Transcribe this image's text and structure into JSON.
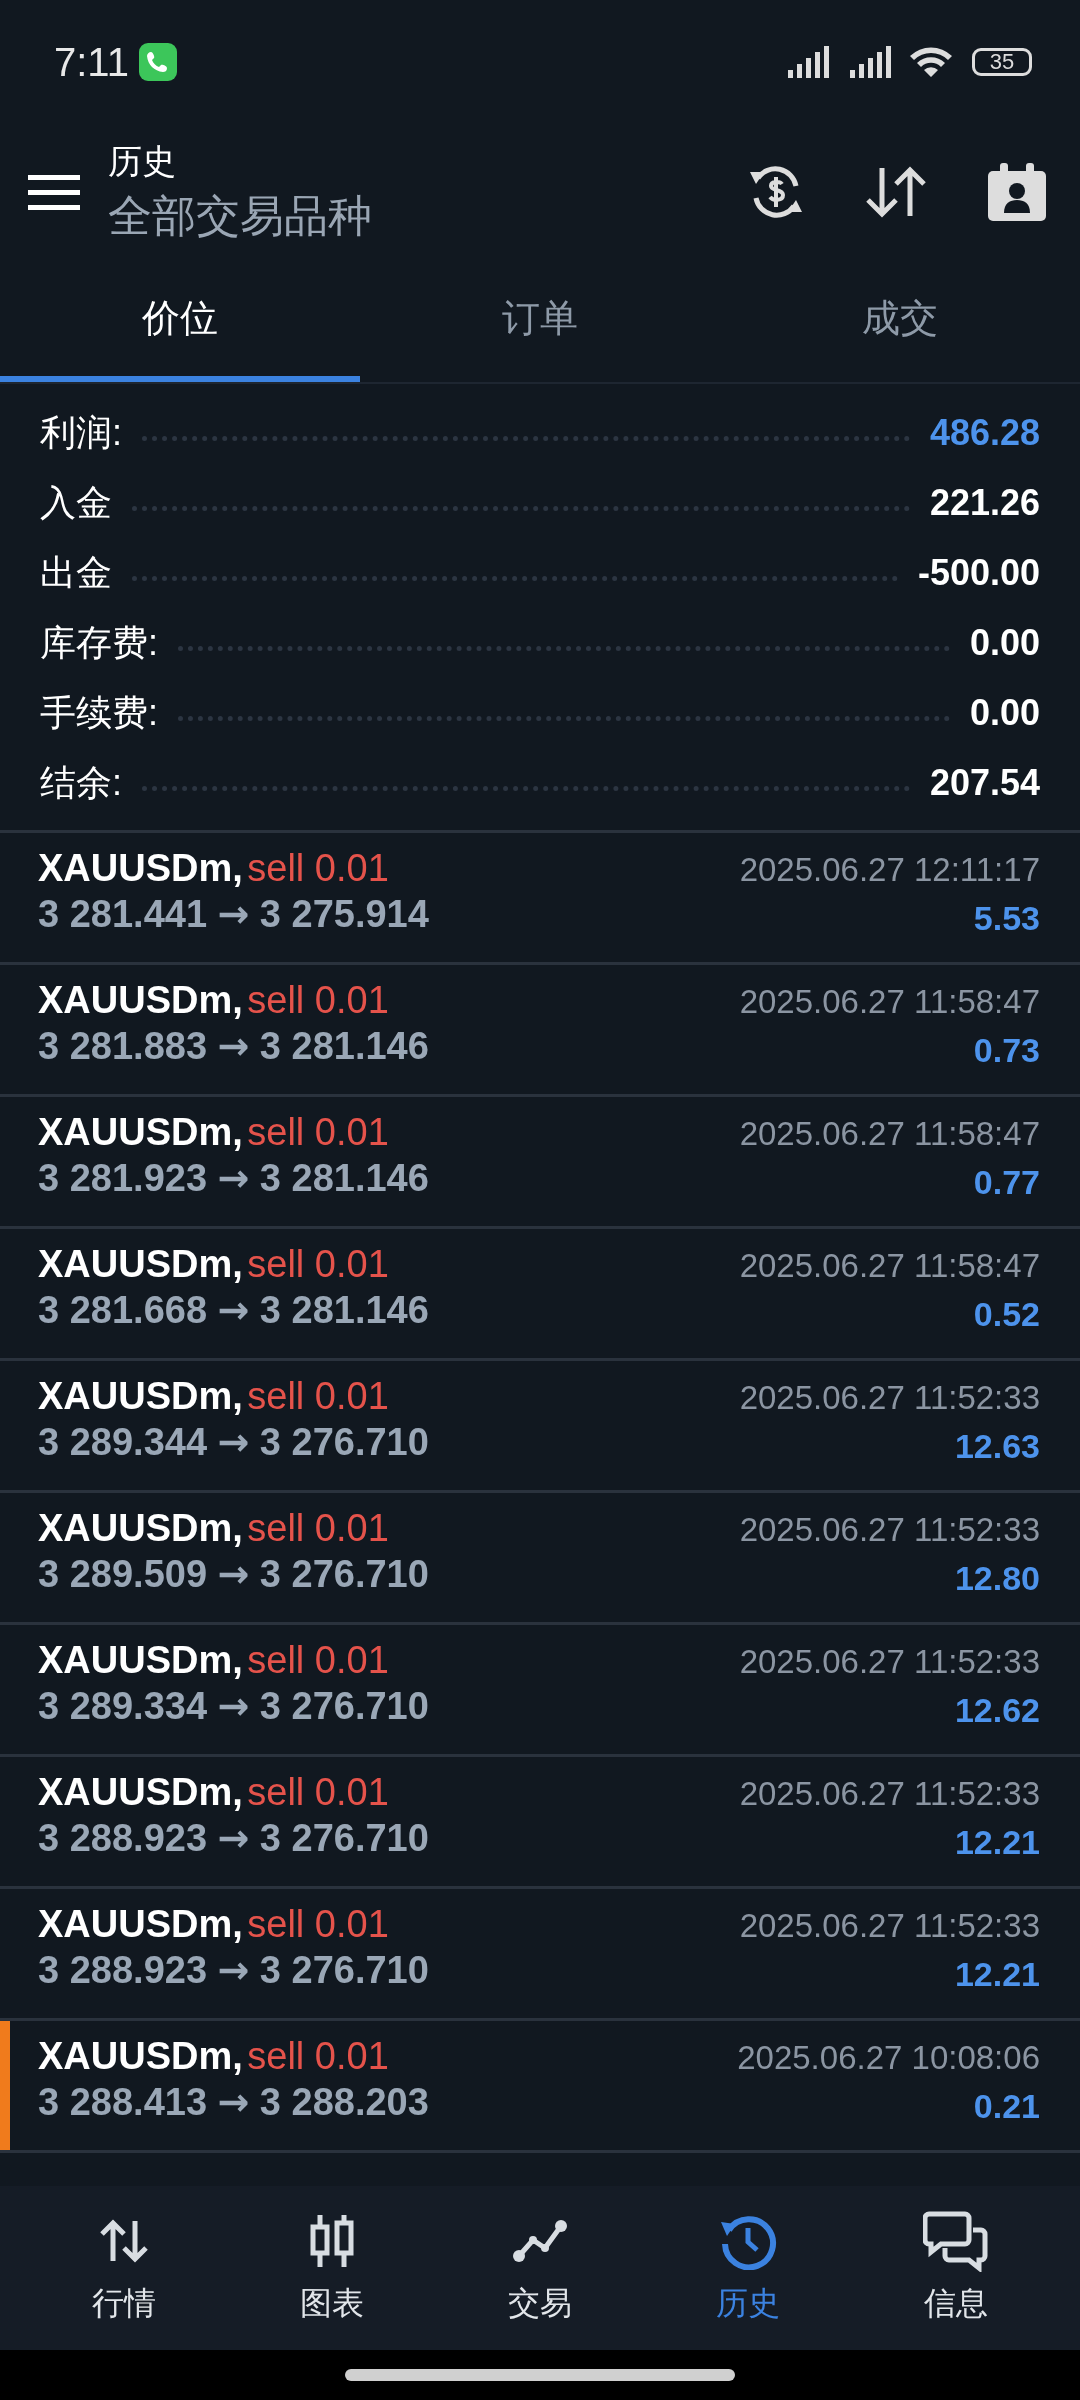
{
  "status_bar": {
    "time": "7:11",
    "battery": "35"
  },
  "header": {
    "title": "历史",
    "subtitle": "全部交易品种"
  },
  "tabs": [
    {
      "label": "价位",
      "selected": true
    },
    {
      "label": "订单",
      "selected": false
    },
    {
      "label": "成交",
      "selected": false
    }
  ],
  "summary": [
    {
      "label": "利润:",
      "value": "486.28",
      "highlight": true
    },
    {
      "label": "入金",
      "value": "221.26",
      "highlight": false
    },
    {
      "label": "出金",
      "value": "-500.00",
      "highlight": false
    },
    {
      "label": "库存费:",
      "value": "0.00",
      "highlight": false
    },
    {
      "label": "手续费:",
      "value": "0.00",
      "highlight": false
    },
    {
      "label": "结余:",
      "value": "207.54",
      "highlight": false
    }
  ],
  "deals": [
    {
      "symbol": "XAUUSDm,",
      "side": "sell 0.01",
      "time": "2025.06.27 12:11:17",
      "open": "3 281.441",
      "arrow": "→",
      "close": "3 275.914",
      "profit": "5.53",
      "selected": false
    },
    {
      "symbol": "XAUUSDm,",
      "side": "sell 0.01",
      "time": "2025.06.27 11:58:47",
      "open": "3 281.883",
      "arrow": "→",
      "close": "3 281.146",
      "profit": "0.73",
      "selected": false
    },
    {
      "symbol": "XAUUSDm,",
      "side": "sell 0.01",
      "time": "2025.06.27 11:58:47",
      "open": "3 281.923",
      "arrow": "→",
      "close": "3 281.146",
      "profit": "0.77",
      "selected": false
    },
    {
      "symbol": "XAUUSDm,",
      "side": "sell 0.01",
      "time": "2025.06.27 11:58:47",
      "open": "3 281.668",
      "arrow": "→",
      "close": "3 281.146",
      "profit": "0.52",
      "selected": false
    },
    {
      "symbol": "XAUUSDm,",
      "side": "sell 0.01",
      "time": "2025.06.27 11:52:33",
      "open": "3 289.344",
      "arrow": "→",
      "close": "3 276.710",
      "profit": "12.63",
      "selected": false
    },
    {
      "symbol": "XAUUSDm,",
      "side": "sell 0.01",
      "time": "2025.06.27 11:52:33",
      "open": "3 289.509",
      "arrow": "→",
      "close": "3 276.710",
      "profit": "12.80",
      "selected": false
    },
    {
      "symbol": "XAUUSDm,",
      "side": "sell 0.01",
      "time": "2025.06.27 11:52:33",
      "open": "3 289.334",
      "arrow": "→",
      "close": "3 276.710",
      "profit": "12.62",
      "selected": false
    },
    {
      "symbol": "XAUUSDm,",
      "side": "sell 0.01",
      "time": "2025.06.27 11:52:33",
      "open": "3 288.923",
      "arrow": "→",
      "close": "3 276.710",
      "profit": "12.21",
      "selected": false
    },
    {
      "symbol": "XAUUSDm,",
      "side": "sell 0.01",
      "time": "2025.06.27 11:52:33",
      "open": "3 288.923",
      "arrow": "→",
      "close": "3 276.710",
      "profit": "12.21",
      "selected": false
    },
    {
      "symbol": "XAUUSDm,",
      "side": "sell 0.01",
      "time": "2025.06.27 10:08:06",
      "open": "3 288.413",
      "arrow": "→",
      "close": "3 288.203",
      "profit": "0.21",
      "selected": true
    }
  ],
  "bottom_nav": [
    {
      "label": "行情",
      "kind": "quotes",
      "selected": false
    },
    {
      "label": "图表",
      "kind": "chart",
      "selected": false
    },
    {
      "label": "交易",
      "kind": "trade",
      "selected": false
    },
    {
      "label": "历史",
      "kind": "history",
      "selected": true
    },
    {
      "label": "信息",
      "kind": "messages",
      "selected": false
    }
  ]
}
